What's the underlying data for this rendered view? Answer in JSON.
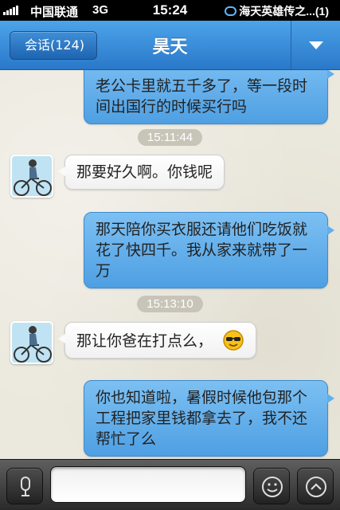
{
  "status_bar": {
    "carrier": "中国联通",
    "network": "3G",
    "time": "15:24",
    "notification": "海天英雄传之...(1)"
  },
  "nav": {
    "back_label": "会话(124)",
    "title": "昊天"
  },
  "messages": [
    {
      "from": "me",
      "text": "老公卡里就五千多了，等一段时间出国行的时候买行吗"
    },
    {
      "timestamp": "15:11:44"
    },
    {
      "from": "friend",
      "text": "那要好久啊。你钱呢"
    },
    {
      "from": "me",
      "text": "那天陪你买衣服还请他们吃饭就花了快四千。我从家来就带了一万"
    },
    {
      "timestamp": "15:13:10"
    },
    {
      "from": "friend",
      "text": "那让你爸在打点么，",
      "emoji": "sunglasses-face"
    },
    {
      "from": "me",
      "text": "你也知道啦，暑假时候他包那个工程把家里钱都拿去了，我不还帮忙了么"
    }
  ],
  "input": {
    "placeholder": "",
    "voice_icon": "microphone-icon",
    "emoji_icon": "smiley-icon",
    "more_icon": "chevron-up-icon"
  },
  "colors": {
    "nav_blue": "#2f80d0",
    "bubble_out": "#5eaeea",
    "bubble_in": "#ffffff"
  }
}
